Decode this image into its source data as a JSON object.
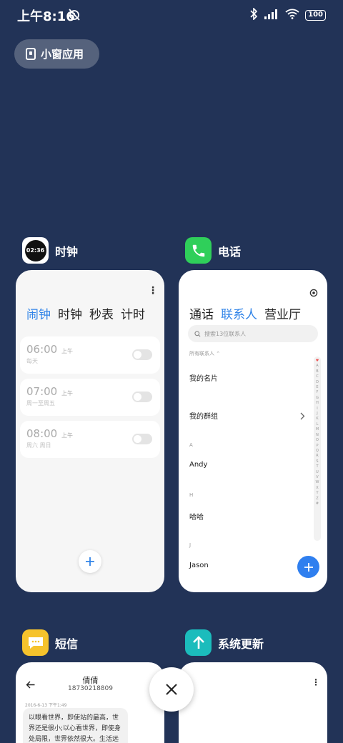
{
  "status_bar": {
    "time": "上午8:16",
    "battery": "100"
  },
  "freeform_button": {
    "label": "小窗应用"
  },
  "clock": {
    "app_name": "时钟",
    "icon_time": "02:36",
    "tabs": [
      "闹钟",
      "时钟",
      "秒表",
      "计时"
    ],
    "alarms": [
      {
        "time": "06:00",
        "ampm": "上午",
        "days": "每天"
      },
      {
        "time": "07:00",
        "ampm": "上午",
        "days": "周一至周五"
      },
      {
        "time": "08:00",
        "ampm": "上午",
        "days": "周六 周日"
      }
    ]
  },
  "phone": {
    "app_name": "电话",
    "tabs": [
      "通话",
      "联系人",
      "营业厅"
    ],
    "search_placeholder": "搜索13位联系人",
    "filter": "所有联系人",
    "my_card": "我的名片",
    "my_groups": "我的群组",
    "sections": [
      {
        "letter": "A",
        "name": "Andy"
      },
      {
        "letter": "H",
        "name": "哈哈"
      },
      {
        "letter": "J",
        "name": "Jason"
      }
    ],
    "index_letters": [
      "A",
      "B",
      "C",
      "D",
      "E",
      "F",
      "G",
      "H",
      "I",
      "J",
      "K",
      "L",
      "M",
      "N",
      "O",
      "P",
      "Q",
      "R",
      "S",
      "T",
      "U",
      "V",
      "W",
      "X",
      "Y",
      "Z",
      "#"
    ]
  },
  "messages": {
    "app_name": "短信",
    "contact_name": "倩倩",
    "contact_number": "18730218809",
    "timestamp": "2016-6-13 下午1:49",
    "message_lines": [
      "以眼看世界，即使站的最高，世",
      "界还是很小;以心看世界，即使身",
      "处局限，世界依然很大。生活远"
    ]
  },
  "update": {
    "app_name": "系统更新"
  },
  "colors": {
    "background": "#223357",
    "accent": "#3184e8",
    "phone_green": "#2fcf5a",
    "sms_yellow": "#f6c32c",
    "update_teal": "#1bbcbc"
  }
}
